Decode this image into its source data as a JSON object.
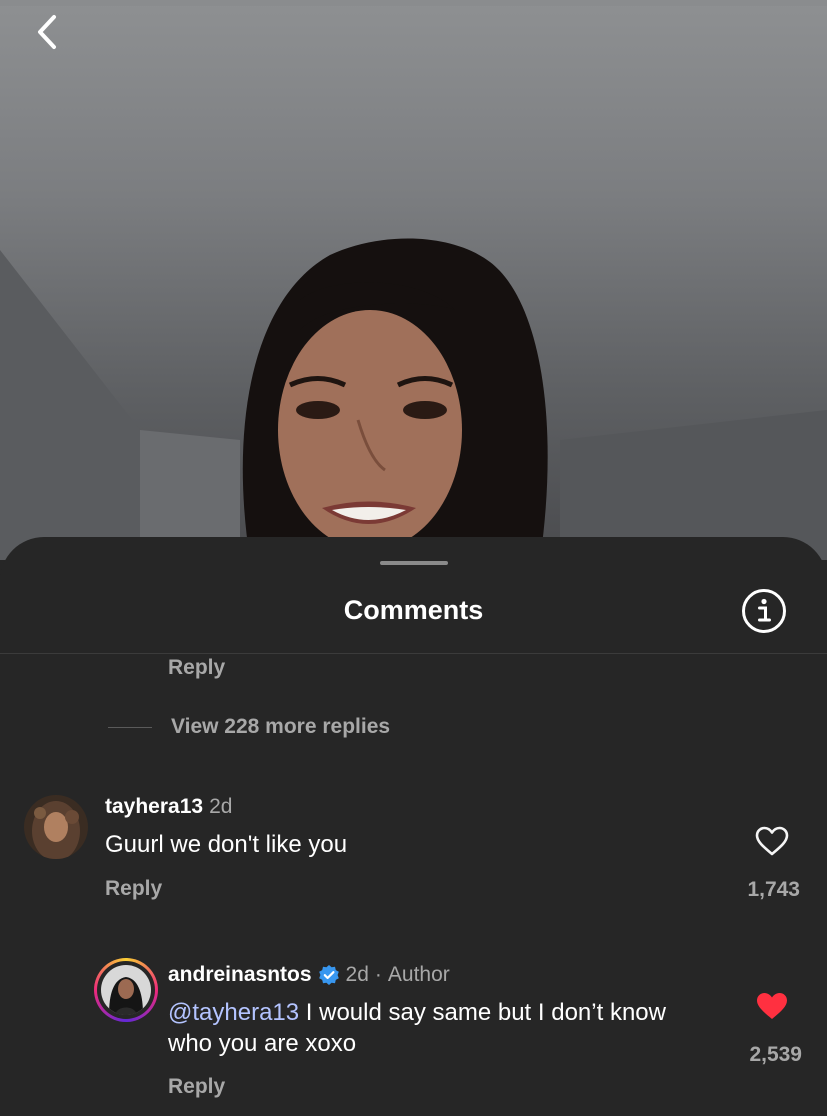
{
  "sheet": {
    "title": "Comments"
  },
  "thread": {
    "reply_label": "Reply",
    "view_more_label": "View 228 more replies"
  },
  "comments": [
    {
      "username": "tayhera13",
      "age": "2d",
      "text": "Guurl we don't like you",
      "reply_label": "Reply",
      "like_count": "1,743",
      "liked": false
    }
  ],
  "replies": [
    {
      "username": "andreinasntos",
      "verified": true,
      "age": "2d",
      "separator": "·",
      "author_badge": "Author",
      "mention": "@tayhera13",
      "text": " I would say same but I don’t know who you are xoxo",
      "reply_label": "Reply",
      "like_count": "2,539",
      "liked": true
    }
  ],
  "icons": {
    "back": "chevron-left-icon",
    "info": "info-icon",
    "like": "heart-icon",
    "verified": "verified-badge-icon"
  },
  "colors": {
    "sheet_bg": "#262626",
    "liked_heart": "#ff3040",
    "verified": "#3897f0",
    "mention": "#b4c4ff"
  }
}
